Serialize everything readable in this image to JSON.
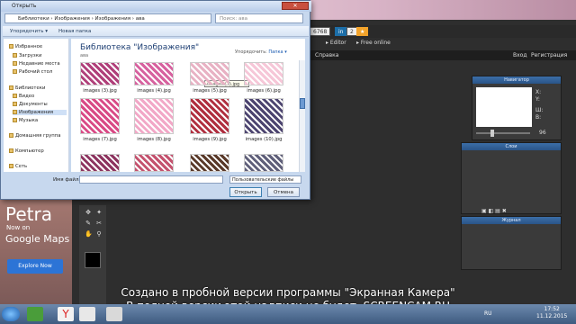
{
  "dialog": {
    "title": "Открыть",
    "address": "Библиотеки › Изображения › Изображения › ава",
    "search_placeholder": "Поиск: ава",
    "toolbar": {
      "organize": "Упорядочить ▾",
      "new_folder": "Новая папка"
    },
    "library_title": "Библиотека \"Изображения\"",
    "library_sub": "ава",
    "arrange_label": "Упорядочить:",
    "arrange_value": "Папка ▾",
    "tooltip": "images (7).jpg",
    "nav": {
      "favorites": "Избранное",
      "downloads": "Загрузки",
      "recent": "Недавние места",
      "desktop": "Рабочий стол",
      "libraries": "Библиотеки",
      "video": "Видео",
      "documents": "Документы",
      "images": "Изображения",
      "music": "Музыка",
      "homegroup": "Домашняя группа",
      "computer": "Компьютер",
      "network": "Сеть"
    },
    "files": [
      {
        "name": "images (3).jpg",
        "color": "#b0407a"
      },
      {
        "name": "images (4).jpg",
        "color": "#d7629f"
      },
      {
        "name": "images (5).jpg",
        "color": "#e8b2c4"
      },
      {
        "name": "images (6).jpg",
        "color": "#f6c7d8"
      },
      {
        "name": "images (7).jpg",
        "color": "#d94b86"
      },
      {
        "name": "images (8).jpg",
        "color": "#f2a8c7"
      },
      {
        "name": "images (9).jpg",
        "color": "#b03040"
      },
      {
        "name": "images (10).jpg",
        "color": "#4d4570"
      },
      {
        "name": "",
        "color": "#8d3560"
      },
      {
        "name": "",
        "color": "#c4536f"
      },
      {
        "name": "",
        "color": "#5a3a2a"
      },
      {
        "name": "",
        "color": "#60607a"
      }
    ],
    "filename_label": "Имя файла:",
    "filetype": "Пользовательские файлы",
    "open_button": "Открыть",
    "cancel_button": "Отмена"
  },
  "app": {
    "badge_count": "6768",
    "badge_in": "in",
    "badge_num": "2",
    "editor_link": "Editor",
    "free_online_link": "Free online",
    "menu_help": "Справка",
    "login": "Вход",
    "register": "Регистрация",
    "navigator_title": "Навигатор",
    "x_label": "X:",
    "y_label": "Y:",
    "w_label": "Ш:",
    "h_label": "В:",
    "zoom_value": "96",
    "layers_title": "Слои",
    "journal_title": "Журнал"
  },
  "ad": {
    "title": "Petra",
    "now_on": "Now on",
    "google_maps": "Google Maps",
    "explore": "Explore Now"
  },
  "watermark": {
    "line1": "Создано в пробной версии программы \"Экранная Камера\"",
    "line2": "В полной версии этой надписи не будет. SCREENCAM.RU"
  },
  "taskbar": {
    "lang": "RU",
    "time": "17:52",
    "date": "11.12.2015"
  }
}
